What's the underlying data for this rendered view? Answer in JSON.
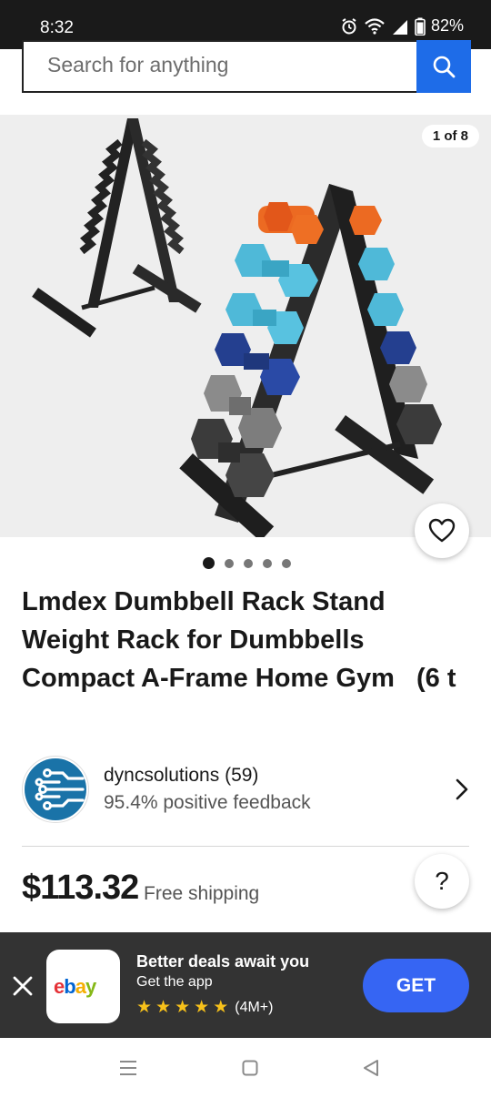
{
  "status_bar": {
    "time": "8:32",
    "battery": "82%",
    "icons": [
      "alarm-icon",
      "wifi-icon",
      "signal-icon",
      "battery-icon"
    ]
  },
  "search": {
    "placeholder": "Search for anything",
    "button_icon": "search-icon"
  },
  "gallery": {
    "counter": "1 of 8",
    "total_images": 8,
    "visible_dots": 5,
    "active_index": 0,
    "favorite_icon": "heart-icon"
  },
  "product": {
    "title": "Lmdex Dumbbell Rack Stand Weight Rack for Dumbbells Compact A-Frame Home Gym   (6 t",
    "price": "$113.32",
    "shipping": "Free shipping"
  },
  "seller": {
    "name": "dyncsolutions (59)",
    "feedback": "95.4% positive feedback",
    "avatar_icon": "circuit-logo-icon"
  },
  "help": {
    "label": "?"
  },
  "app_banner": {
    "logo_text": "ebay",
    "title": "Better deals await you",
    "subtitle": "Get the app",
    "rating_stars": 5,
    "rating_count": "(4M+)",
    "cta": "GET"
  },
  "colors": {
    "accent_blue": "#3665f3",
    "search_blue": "#1e6ce8",
    "star_yellow": "#f7c11a",
    "banner_bg": "#333333",
    "ebay_red": "#e53238",
    "ebay_blue": "#0064d2",
    "ebay_yellow": "#f5af02",
    "ebay_green": "#86b817",
    "seller_logo_blue": "#1a73a8"
  }
}
